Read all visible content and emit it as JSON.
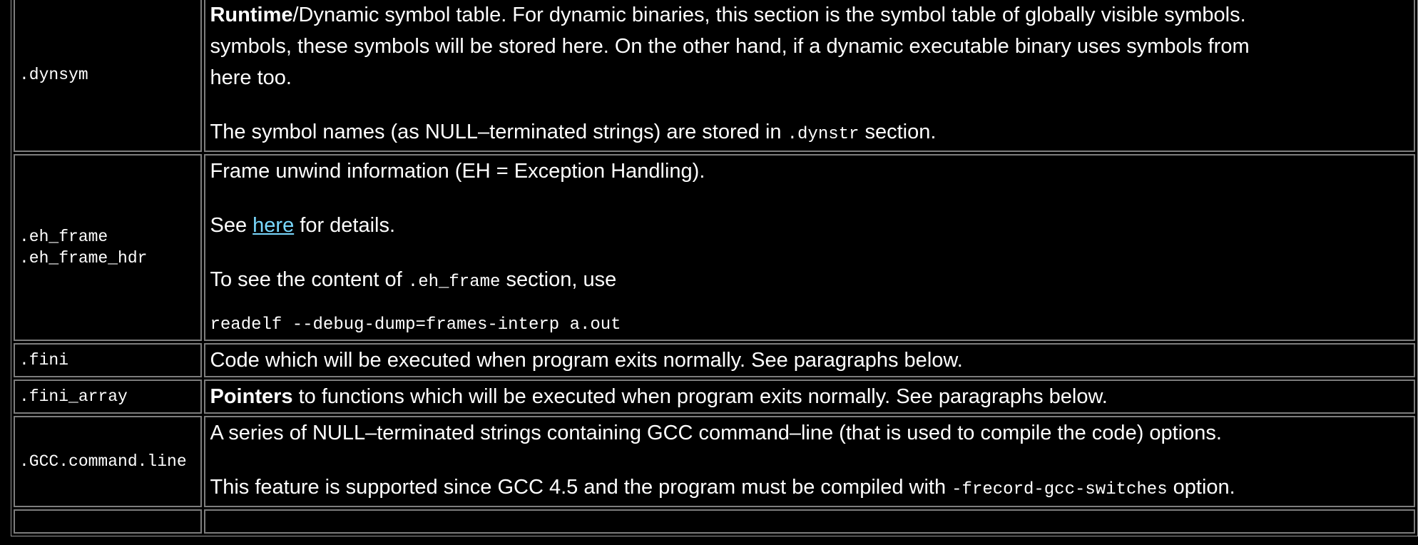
{
  "rows": {
    "prev": {
      "name": "",
      "desc": ""
    },
    "dynsym": {
      "name": ".dynsym",
      "p1_bold": "Runtime",
      "p1_rest": "/Dynamic symbol table. For dynamic binaries, this section is the symbol table of globally visible symbols.",
      "p1_line2": "symbols, these symbols will be stored here. On the other hand, if a dynamic executable binary uses symbols from",
      "p1_line3": "here too.",
      "p2_a": "The symbol names (as NULL–terminated strings) are stored in ",
      "p2_code": ".dynstr",
      "p2_b": " section."
    },
    "eh_frame": {
      "name_line1": ".eh_frame",
      "name_line2": ".eh_frame_hdr",
      "p1": "Frame unwind information (EH = Exception Handling).",
      "p2_a": "See ",
      "p2_link": "here",
      "p2_b": " for details.",
      "p3_a": "To see the content of ",
      "p3_code": ".eh_frame",
      "p3_b": " section, use",
      "command": "readelf --debug-dump=frames-interp a.out"
    },
    "fini": {
      "name": ".fini",
      "desc": "Code which will be executed when program exits normally. See paragraphs below."
    },
    "fini_array": {
      "name": ".fini_array",
      "bold": "Pointers",
      "rest": " to functions which will be executed when program exits normally. See paragraphs below."
    },
    "gcc": {
      "name": ".GCC.command.line",
      "p1": "A series of NULL–terminated strings containing GCC command–line (that is used to compile the code) options.",
      "p2_a": "This feature is supported since GCC 4.5 and the program must be compiled with ",
      "p2_code": "-frecord-gcc-switches",
      "p2_b": " option."
    }
  },
  "colors": {
    "background": "#000000",
    "text": "#ffffff",
    "border": "#7d7d7d",
    "link": "#7ad9ff"
  }
}
